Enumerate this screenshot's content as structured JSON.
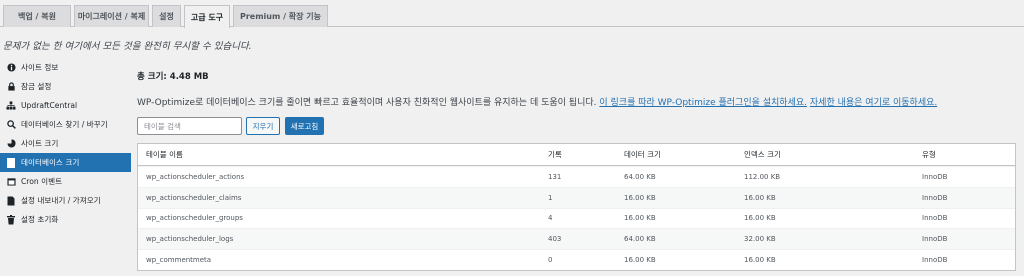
{
  "tabs": [
    "백업 / 복원",
    "마이그레이션 / 복제",
    "설정",
    "고급 도구",
    "Premium / 확장 기능"
  ],
  "active_tab": "고급 도구",
  "notice": "문제가 없는 한 여기에서 모든 것을 완전히 무시할 수 있습니다.",
  "sidebar": [
    {
      "label": "사이트 정보",
      "icon": "info-icon"
    },
    {
      "label": "잠금 설정",
      "icon": "lock-icon"
    },
    {
      "label": "UpdraftCentral",
      "icon": "network-icon"
    },
    {
      "label": "데이터베이스 찾기 / 바꾸기",
      "icon": "search-icon"
    },
    {
      "label": "사이트 크기",
      "icon": "chart-icon"
    },
    {
      "label": "데이터베이스 크기",
      "icon": "database-icon",
      "active": true
    },
    {
      "label": "Cron 이벤트",
      "icon": "calendar-icon"
    },
    {
      "label": "설정 내보내기 / 가져오기",
      "icon": "document-icon"
    },
    {
      "label": "설정 초기화",
      "icon": "trash-icon"
    }
  ],
  "main": {
    "total": "총 크기: 4.48 MB",
    "desc": "WP-Optimize로 데이터베이스 크기를 줄이면 빠르고 효율적이며 사용자 친화적인 웹사이트를 유지하는 데 도움이 됩니다.",
    "link1": "이 링크를 따라 WP-Optimize 플러그인을 설치하세요.",
    "link2": "자세한 내용은 여기로 이동하세요.",
    "search_placeholder": "테이블 검색",
    "clear_label": "지우기",
    "refresh_label": "새로고침",
    "columns": [
      "테이블 이름",
      "기록",
      "데이터 크기",
      "인덱스 크기",
      "유형"
    ],
    "rows": [
      [
        "wp_actionscheduler_actions",
        "131",
        "64.00 KB",
        "112.00 KB",
        "InnoDB"
      ],
      [
        "wp_actionscheduler_claims",
        "1",
        "16.00 KB",
        "16.00 KB",
        "InnoDB"
      ],
      [
        "wp_actionscheduler_groups",
        "4",
        "16.00 KB",
        "16.00 KB",
        "InnoDB"
      ],
      [
        "wp_actionscheduler_logs",
        "403",
        "64.00 KB",
        "32.00 KB",
        "InnoDB"
      ],
      [
        "wp_commentmeta",
        "0",
        "16.00 KB",
        "16.00 KB",
        "InnoDB"
      ]
    ]
  },
  "colors": {
    "accent": "#2271b1",
    "background": "#f0f0f1"
  }
}
